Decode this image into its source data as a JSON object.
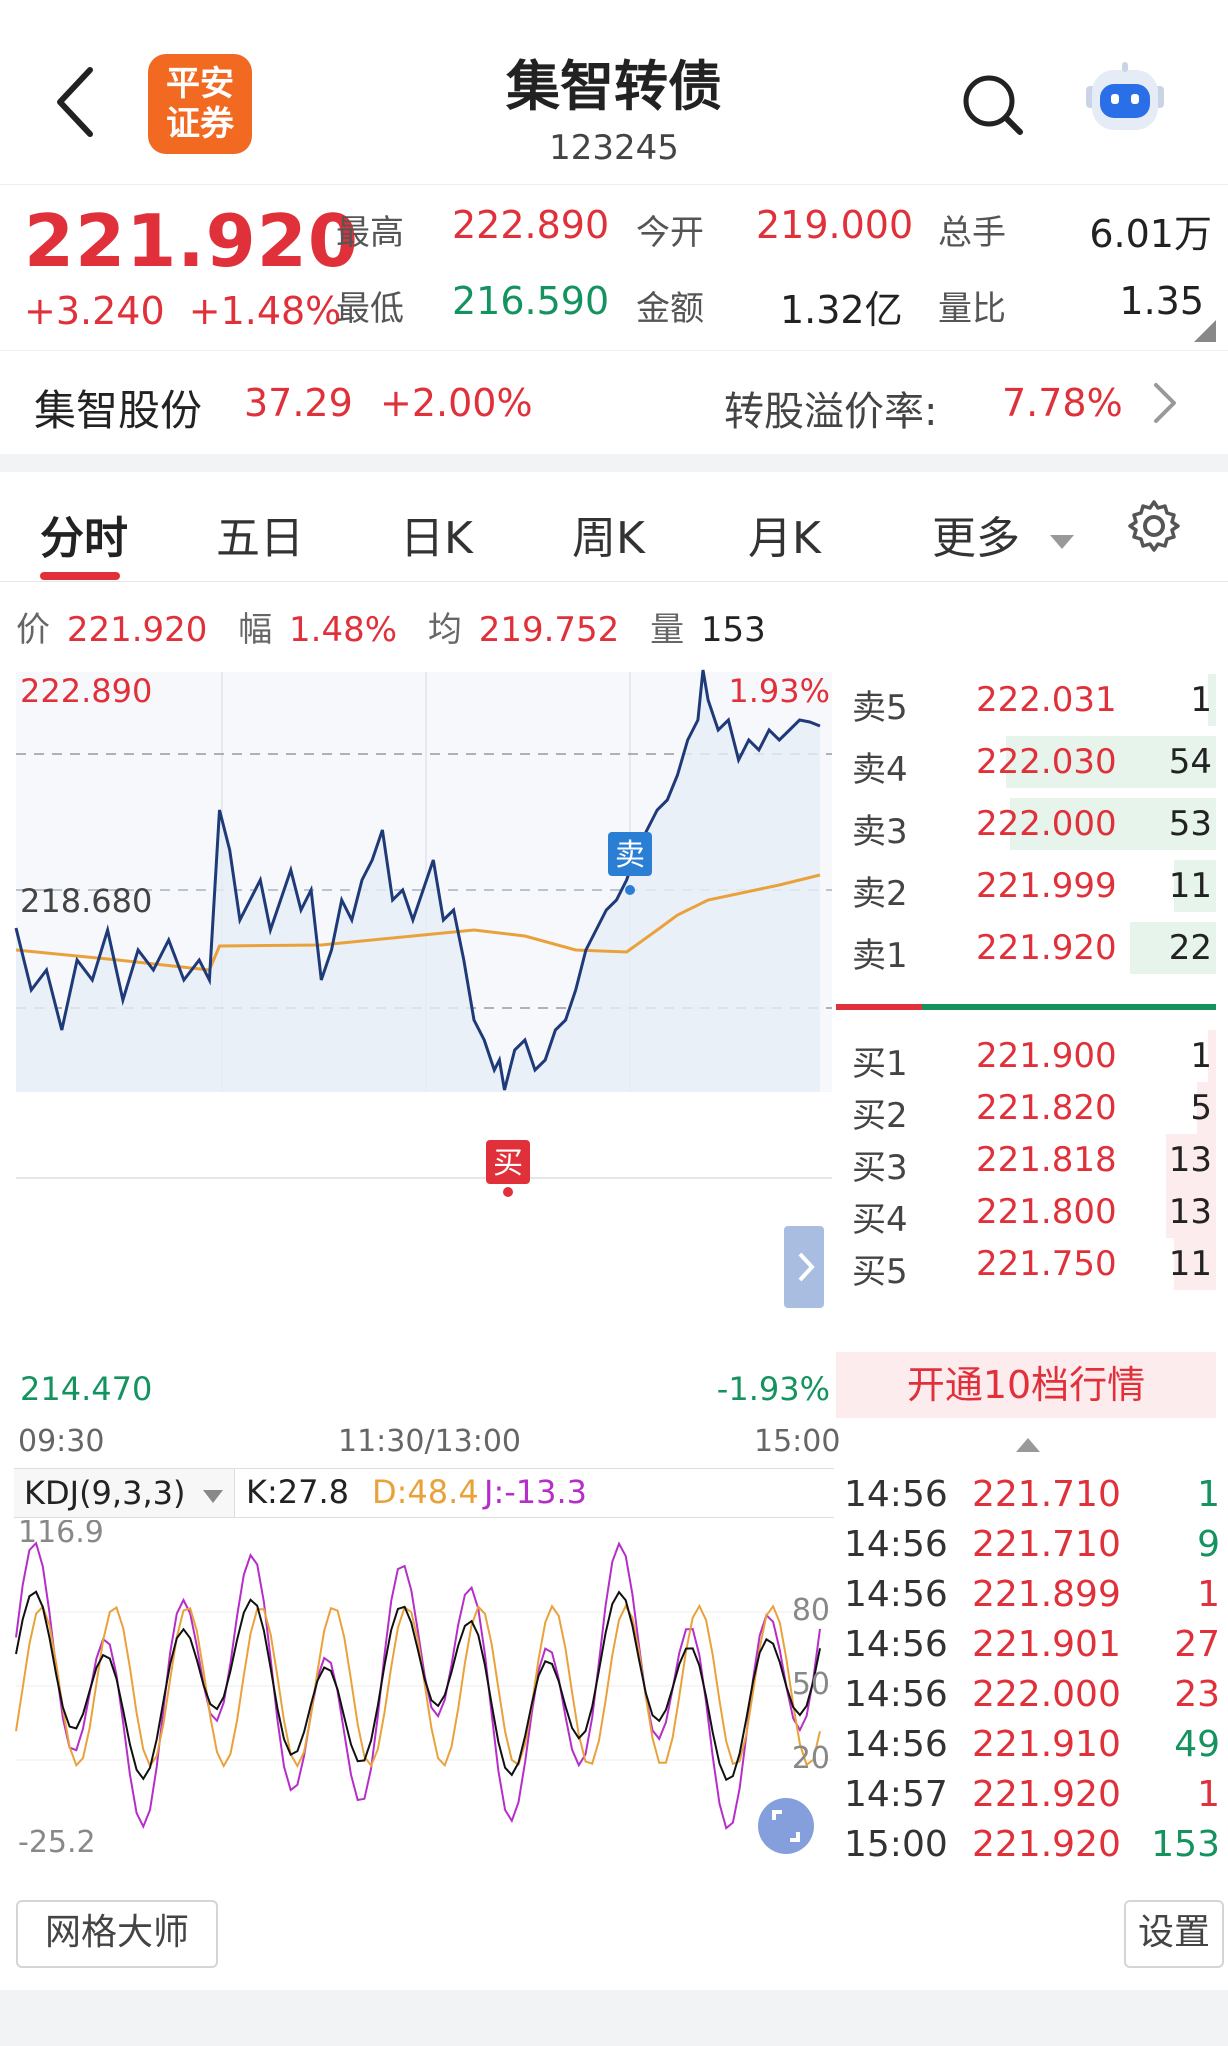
{
  "header": {
    "title": "集智转债",
    "code": "123245",
    "broker_logo_line1": "平安",
    "broker_logo_line2": "证券"
  },
  "quote": {
    "last_price": "221.920",
    "change": "+3.240",
    "change_pct": "+1.48%",
    "fields": [
      {
        "label": "最高",
        "value": "222.890"
      },
      {
        "label": "今开",
        "value": "219.000"
      },
      {
        "label": "总手",
        "value": "6.01万"
      },
      {
        "label": "最低",
        "value": "216.590"
      },
      {
        "label": "金额",
        "value": "1.32亿"
      },
      {
        "label": "量比",
        "value": "1.35"
      }
    ]
  },
  "stock": {
    "name": "集智股份",
    "price": "37.29",
    "change_pct": "+2.00%",
    "premium_label": "转股溢价率:",
    "premium_value": "7.78%"
  },
  "tabs": [
    "分时",
    "五日",
    "日K",
    "周K",
    "月K",
    "更多"
  ],
  "info": {
    "price_label": "价",
    "price": "221.920",
    "range_label": "幅",
    "range": "1.48%",
    "avg_label": "均",
    "avg": "219.752",
    "vol_label": "量",
    "vol": "153"
  },
  "chart": {
    "y_high": "222.890",
    "y_mid": "218.680",
    "y_low": "214.470",
    "pct_high": "1.93%",
    "pct_low": "-1.93%",
    "x_start": "09:30",
    "x_mid": "11:30/13:00",
    "x_end": "15:00",
    "buy_mark": "买",
    "sell_mark": "卖",
    "colors": {
      "price_line": "#1f3a78",
      "avg_line": "#e9a23b",
      "up": "#e0313b",
      "down": "#14935f"
    }
  },
  "kdj": {
    "label": "KDJ(9,3,3)",
    "k": "K:27.8",
    "d": "D:48.4",
    "j": "J:-13.3",
    "y_max": "116.9",
    "y_min": "-25.2",
    "level_80": "80",
    "level_50": "50",
    "level_20": "20"
  },
  "order_book": {
    "asks": [
      {
        "label": "卖5",
        "price": "222.031",
        "vol": "1",
        "depth": 0.02
      },
      {
        "label": "卖4",
        "price": "222.030",
        "vol": "54",
        "depth": 1.0
      },
      {
        "label": "卖3",
        "price": "222.000",
        "vol": "53",
        "depth": 0.98
      },
      {
        "label": "卖2",
        "price": "221.999",
        "vol": "11",
        "depth": 0.2
      },
      {
        "label": "卖1",
        "price": "221.920",
        "vol": "22",
        "depth": 0.41
      }
    ],
    "bids": [
      {
        "label": "买1",
        "price": "221.900",
        "vol": "1",
        "depth": 0.02
      },
      {
        "label": "买2",
        "price": "221.820",
        "vol": "5",
        "depth": 0.09
      },
      {
        "label": "买3",
        "price": "221.818",
        "vol": "13",
        "depth": 0.24
      },
      {
        "label": "买4",
        "price": "221.800",
        "vol": "13",
        "depth": 0.24
      },
      {
        "label": "买5",
        "price": "221.750",
        "vol": "11",
        "depth": 0.2
      }
    ],
    "upgrade_label": "开通10档行情"
  },
  "ticks": [
    {
      "time": "14:56",
      "price": "221.710",
      "vol": "1",
      "dir": "down"
    },
    {
      "time": "14:56",
      "price": "221.710",
      "vol": "9",
      "dir": "down"
    },
    {
      "time": "14:56",
      "price": "221.899",
      "vol": "1",
      "dir": "up"
    },
    {
      "time": "14:56",
      "price": "221.901",
      "vol": "27",
      "dir": "up"
    },
    {
      "time": "14:56",
      "price": "222.000",
      "vol": "23",
      "dir": "up"
    },
    {
      "time": "14:56",
      "price": "221.910",
      "vol": "49",
      "dir": "down"
    },
    {
      "time": "14:57",
      "price": "221.920",
      "vol": "1",
      "dir": "up"
    },
    {
      "time": "15:00",
      "price": "221.920",
      "vol": "153",
      "dir": "down"
    }
  ],
  "bottom": {
    "grid_btn": "网格大师",
    "settings_btn": "设置"
  }
}
